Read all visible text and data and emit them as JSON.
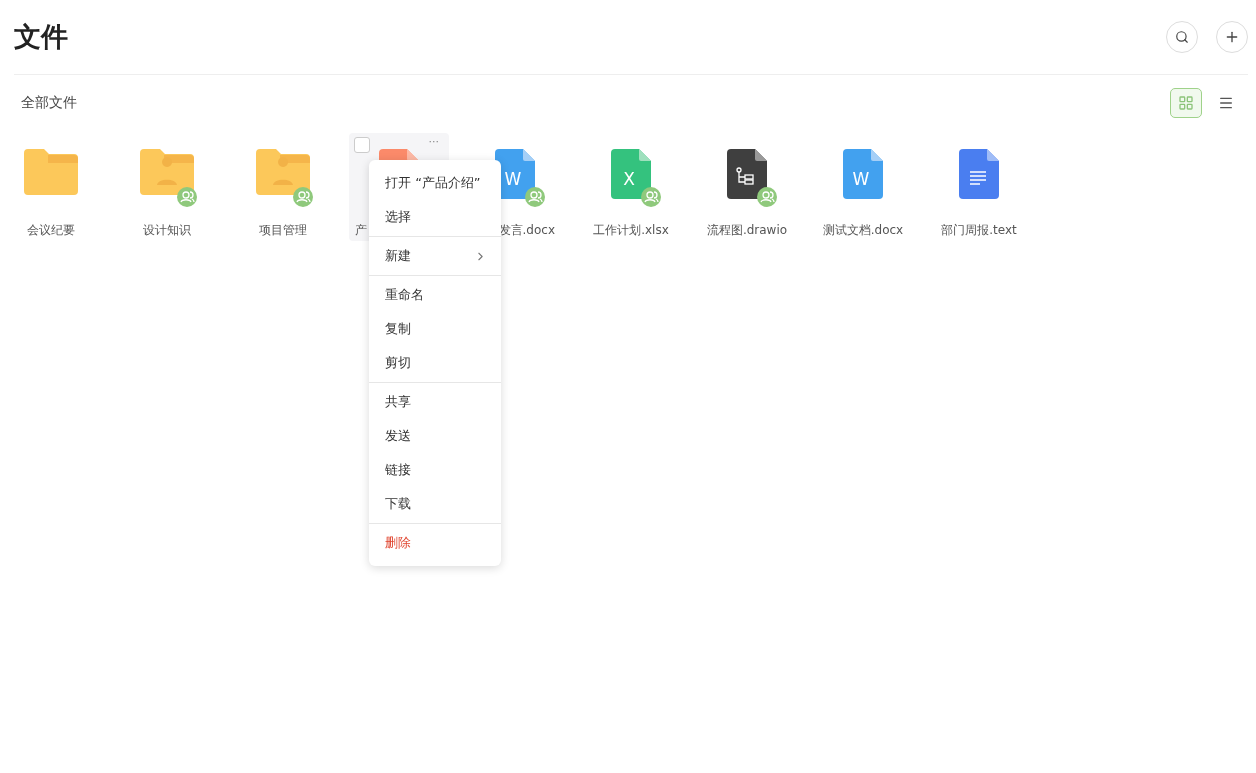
{
  "header": {
    "title": "文件"
  },
  "breadcrumb": "全部文件",
  "views": [
    {
      "kind": "grid",
      "selected": true
    },
    {
      "kind": "list",
      "selected": false
    }
  ],
  "items": [
    {
      "kind": "folder",
      "name": "会议纪要",
      "shared": false,
      "people": false,
      "selected": false
    },
    {
      "kind": "folder",
      "name": "设计知识",
      "shared": true,
      "people": true,
      "selected": false
    },
    {
      "kind": "folder",
      "name": "项目管理",
      "shared": true,
      "people": true,
      "selected": false
    },
    {
      "kind": "pdf",
      "name": "产",
      "cut_end": true,
      "shared": false,
      "selected": true,
      "checked": false,
      "more": "···"
    },
    {
      "kind": "word",
      "name": "发言.docx",
      "cut_start": true,
      "shared": true,
      "selected": false,
      "letter": "W"
    },
    {
      "kind": "excel",
      "name": "工作计划.xlsx",
      "shared": true,
      "selected": false,
      "letter": "X"
    },
    {
      "kind": "drawio",
      "name": "流程图.drawio",
      "shared": true,
      "selected": false
    },
    {
      "kind": "word",
      "name": "测试文档.docx",
      "shared": false,
      "selected": false,
      "letter": "W"
    },
    {
      "kind": "text",
      "name": "部门周报.text",
      "shared": false,
      "selected": false
    }
  ],
  "context_menu": {
    "groups": [
      [
        {
          "label": "打开 “产品介绍”",
          "danger": false,
          "submenu": false
        },
        {
          "label": "选择",
          "danger": false,
          "submenu": false
        }
      ],
      [
        {
          "label": "新建",
          "danger": false,
          "submenu": true
        }
      ],
      [
        {
          "label": "重命名",
          "danger": false,
          "submenu": false
        },
        {
          "label": "复制",
          "danger": false,
          "submenu": false
        },
        {
          "label": "剪切",
          "danger": false,
          "submenu": false
        }
      ],
      [
        {
          "label": "共享",
          "danger": false,
          "submenu": false
        },
        {
          "label": "发送",
          "danger": false,
          "submenu": false
        },
        {
          "label": "链接",
          "danger": false,
          "submenu": false
        },
        {
          "label": "下载",
          "danger": false,
          "submenu": false
        }
      ],
      [
        {
          "label": "删除",
          "danger": true,
          "submenu": false
        }
      ]
    ]
  }
}
